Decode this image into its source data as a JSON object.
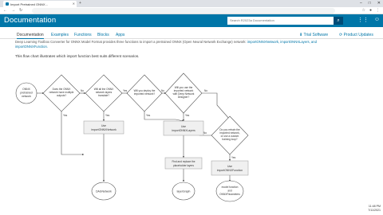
{
  "browser": {
    "tab_title": "Import Pretrained ONNX...",
    "url": "",
    "new_tab": "+",
    "window_controls": [
      "–",
      "□",
      "✕"
    ]
  },
  "header": {
    "title": "Documentation",
    "search_placeholder": "Search R2023a Documentation"
  },
  "subnav": {
    "items": [
      {
        "label": "Documentation",
        "active": true
      },
      {
        "label": "Examples",
        "active": false
      },
      {
        "label": "Functions",
        "active": false
      },
      {
        "label": "Blocks",
        "active": false
      },
      {
        "label": "Apps",
        "active": false
      }
    ],
    "trial_label": "Trial Software",
    "updates_label": "Product Updates"
  },
  "content": {
    "line1": "Deep Learning Toolbox Converter for ONNX Model Format provides three functions to import a pretrained ONNX (Open Neural Network Exchange) network:",
    "line1_links": "importONNXNetwork, importONNXLayers, and",
    "line2_link": "importONNXFunction.",
    "intro": "This flow chart illustrates which import function best suits different scenarios."
  },
  "flowchart": {
    "start": [
      "ONNX",
      "pretrained",
      "network"
    ],
    "q1": [
      "Does the ONNX",
      "network have multiple",
      "outputs?"
    ],
    "q2": [
      "Will all the ONNX",
      "network layers",
      "translate?"
    ],
    "q3": [
      "Will you deploy the",
      "imported network?"
    ],
    "q4": [
      "Will you use the",
      "imported network",
      "with Deep Network",
      "Designer?"
    ],
    "q5": [
      "Do you retrain the",
      "imported network,",
      "or use a custom",
      "training loop?"
    ],
    "box1": [
      "Use",
      "importONNXNetwork"
    ],
    "box2": [
      "Use",
      "importONNXLayers"
    ],
    "box3": [
      "Find and replace the",
      "placeholder layers"
    ],
    "box4": [
      "Use",
      "importONNXFunction"
    ],
    "end1": [
      "DAGNetwork"
    ],
    "end2": [
      "layerGraph"
    ],
    "end3": [
      "model function",
      "and",
      "ONNXParameters"
    ],
    "yes": "Yes",
    "no": "No"
  },
  "taskbar": {
    "time": "11:48 PM",
    "date": "7/11/2021"
  },
  "colors": {
    "brand": "#0076a8",
    "link": "#0076a8"
  }
}
